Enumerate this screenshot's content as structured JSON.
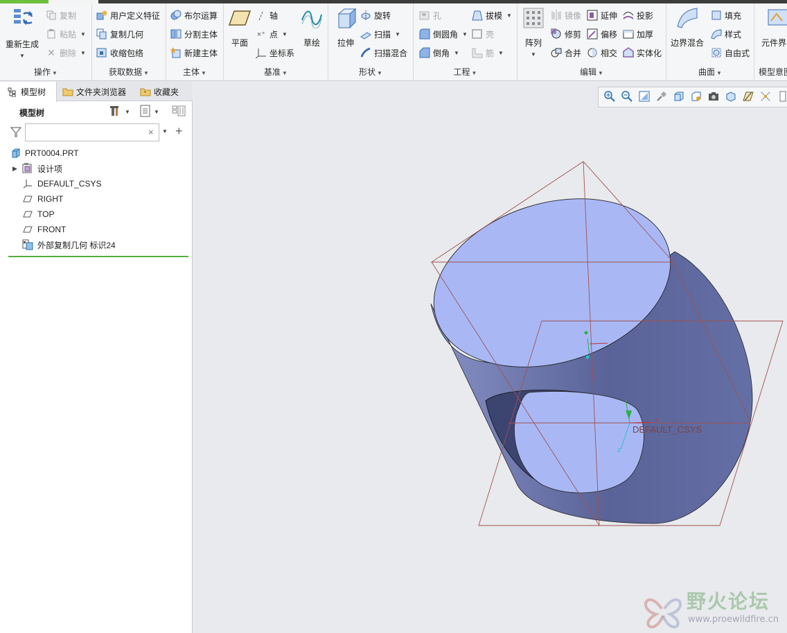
{
  "ribbon": {
    "groups": {
      "operations": {
        "label": "操作",
        "regenerate": "重新生成",
        "copy": "复制",
        "paste": "粘贴",
        "delete": "删除"
      },
      "get_data": {
        "label": "获取数据",
        "udf": "用户定义特征",
        "copy_geom": "复制几何",
        "shrinkwrap": "收缩包络"
      },
      "body": {
        "label": "主体",
        "boolean": "布尔运算",
        "split_body": "分割主体",
        "new_body": "新建主体"
      },
      "datum": {
        "label": "基准",
        "plane": "平面",
        "axis": "轴",
        "point": "点",
        "csys": "坐标系",
        "sketch": "草绘"
      },
      "shapes": {
        "label": "形状",
        "extrude": "拉伸",
        "revolve": "旋转",
        "sweep": "扫描",
        "swept_blend": "扫描混合"
      },
      "engineering": {
        "label": "工程",
        "hole": "孔",
        "round": "倒圆角",
        "chamfer": "倒角",
        "draft": "拔模",
        "shell": "壳",
        "rib": "筋"
      },
      "editing": {
        "label": "编辑",
        "pattern": "阵列",
        "mirror": "镜像",
        "trim": "修剪",
        "merge": "合并",
        "extend": "延伸",
        "offset": "偏移",
        "intersect": "相交",
        "project": "投影",
        "thicken": "加厚",
        "solidify": "实体化"
      },
      "surfaces": {
        "label": "曲面",
        "boundary_blend": "边界混合",
        "fill": "填充",
        "style": "样式",
        "freestyle": "自由式"
      },
      "model_intent": {
        "label": "模型意图",
        "component_interface": "元件界面"
      }
    }
  },
  "left_panel": {
    "tabs": {
      "model_tree": "模型树",
      "folder_browser": "文件夹浏览器",
      "favorites": "收藏夹"
    },
    "tree_title": "模型树",
    "search": {
      "value": "",
      "placeholder": ""
    },
    "tree": {
      "root": "PRT0004.PRT",
      "design_items": "设计项",
      "csys": "DEFAULT_CSYS",
      "right": "RIGHT",
      "top": "TOP",
      "front": "FRONT",
      "ext_copy": "外部复制几何 标识24"
    }
  },
  "graphics": {
    "csys_label": "DEFAULT_CSYS",
    "model_fill": "#a9b8f5",
    "model_shade": "#5f6aa0",
    "datum_color": "#a05050"
  },
  "watermark": {
    "title": "野火论坛",
    "url": "www.proewildfire.cn"
  }
}
